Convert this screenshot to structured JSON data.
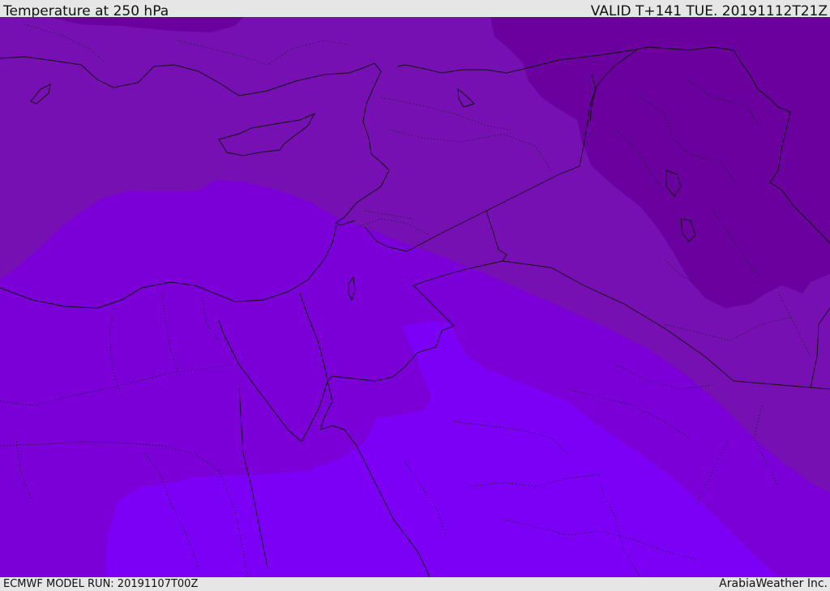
{
  "header": {
    "title": "Temperature at 250 hPa",
    "valid": "VALID T+141 TUE. 20191112T21Z"
  },
  "footer": {
    "model_run": "ECMWF MODEL RUN: 20191107T00Z",
    "brand": "ArabiaWeather Inc."
  },
  "colors": {
    "band_darkest": "#6a009e",
    "band_dark": "#7710b2",
    "band_mid": "#7b00d8",
    "band_bright": "#7d00f6",
    "boundary": "#111111",
    "header_bg": "#e6e6e6"
  }
}
